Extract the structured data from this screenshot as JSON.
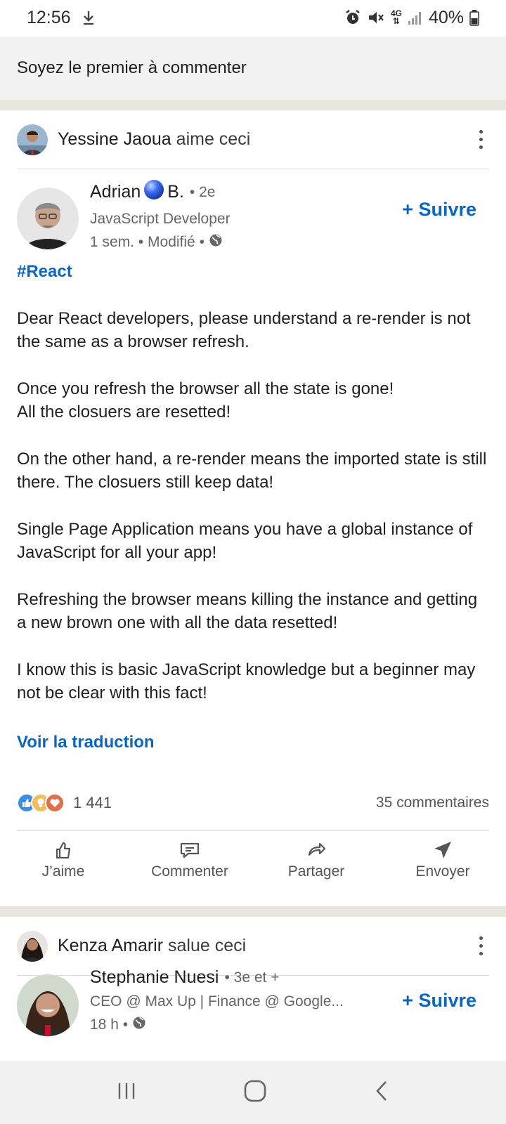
{
  "status_bar": {
    "time": "12:56",
    "network": "4G",
    "battery": "40%"
  },
  "top_comment_prompt": "Soyez le premier à commenter",
  "feed": {
    "post1": {
      "actor_name": "Yessine Jaoua",
      "actor_action": " aime ceci",
      "author_first": "Adrian",
      "author_last": "B.",
      "author_degree": "• 2e",
      "author_headline": "JavaScript Developer",
      "author_time": "1 sem. • Modifié •",
      "follow_label": "+ Suivre",
      "hashtag": "#React",
      "paragraphs": [
        "Dear React developers, please understand a re-render is not the same as a browser refresh.",
        "Once you refresh the browser all the state is gone!\nAll the closuers are resetted!",
        "On the other hand, a re-render means the imported state is still there. The closuers still keep data!",
        "Single Page Application means you have a global instance of JavaScript for all your app!",
        "Refreshing the browser means killing the instance and getting a new brown one with all the data resetted!",
        "I know this is basic JavaScript knowledge but a beginner may not be clear with this fact!"
      ],
      "translate_label": "Voir la traduction",
      "reaction_count": "1 441",
      "comment_count": "35 commentaires"
    },
    "actions": {
      "like": "J’aime",
      "comment": "Commenter",
      "share": "Partager",
      "send": "Envoyer"
    },
    "post2": {
      "actor_name": "Kenza Amarir",
      "actor_action": " salue ceci",
      "author_name": "Stephanie Nuesi",
      "author_degree": "• 3e et +",
      "author_headline": "CEO @ Max Up | Finance @ Google...",
      "author_time": "18 h •",
      "follow_label": "+ Suivre"
    }
  },
  "colors": {
    "link_blue": "#0a66c2",
    "separator": "#e9e6df"
  }
}
